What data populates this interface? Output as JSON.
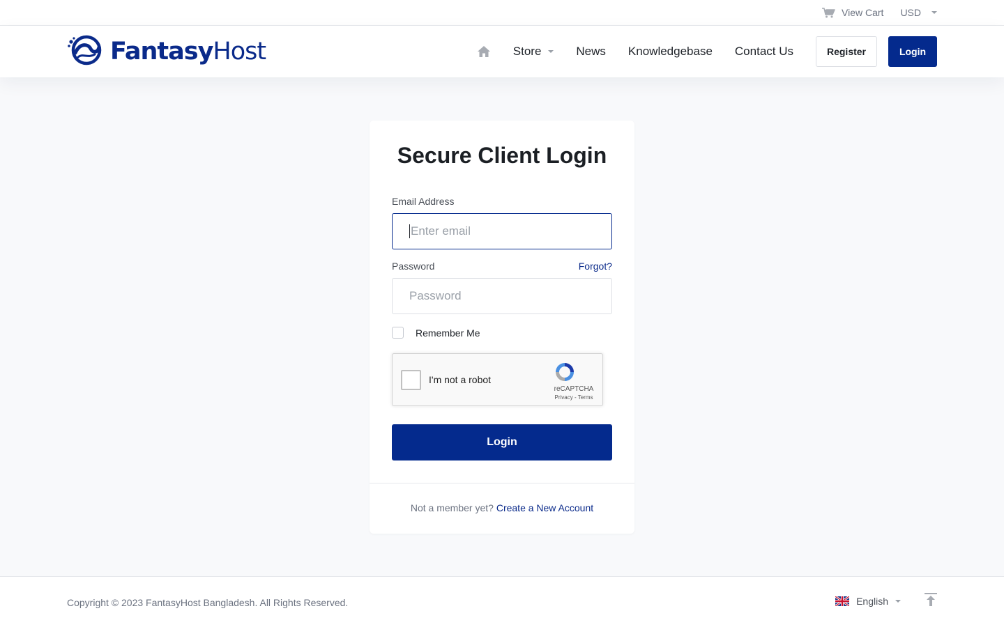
{
  "topbar": {
    "cart_label": "View Cart",
    "currency": "USD"
  },
  "header": {
    "logo_bold": "Fantasy",
    "logo_light": "Host",
    "nav": {
      "store": "Store",
      "news": "News",
      "knowledgebase": "Knowledgebase",
      "contact": "Contact Us"
    },
    "register_label": "Register",
    "login_label": "Login"
  },
  "login_card": {
    "title": "Secure Client Login",
    "email_label": "Email Address",
    "email_placeholder": "Enter email",
    "password_label": "Password",
    "forgot_label": "Forgot?",
    "password_placeholder": "Password",
    "remember_label": "Remember Me",
    "recaptcha": {
      "label": "I'm not a robot",
      "brand": "reCAPTCHA",
      "terms": "Privacy - Terms"
    },
    "submit_label": "Login",
    "footer_prompt": "Not a member yet?",
    "footer_link": "Create a New Account"
  },
  "footer": {
    "copyright": "Copyright © 2023 FantasyHost Bangladesh. All Rights Reserved.",
    "language": "English"
  },
  "colors": {
    "brand": "#042a8d",
    "link": "#0a2a8a",
    "background": "#f8f9fb"
  },
  "icons": {
    "cart": "cart-icon",
    "home": "home-icon",
    "flag": "uk-flag-icon",
    "back_to_top": "arrow-up-to-line-icon",
    "logo_mark": "globe-wave-logo-icon"
  }
}
